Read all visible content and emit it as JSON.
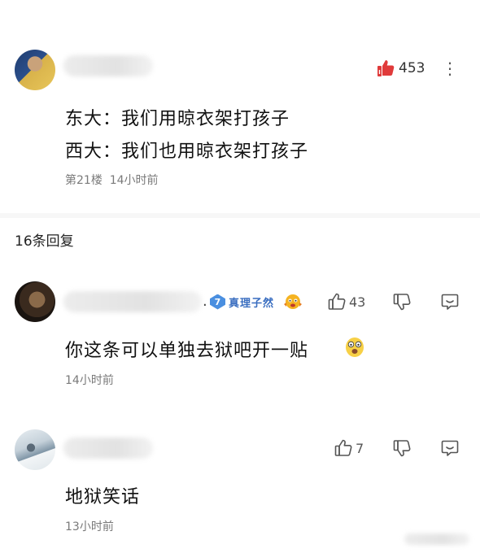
{
  "post": {
    "like_count": "453",
    "line1": "东大：我们用晾衣架打孩子",
    "line2": "西大：我们也用晾衣架打孩子",
    "floor": "第21楼",
    "time": "14小时前",
    "more": "⋮"
  },
  "replies_header": "16条回复",
  "replies": [
    {
      "separator": ".",
      "level": "7",
      "badge_title": "真理子然",
      "like_count": "43",
      "text": "你这条可以单独去狱吧开一贴",
      "time": "14小时前"
    },
    {
      "like_count": "7",
      "text": "地狱笑话",
      "time": "13小时前"
    }
  ],
  "colors": {
    "like_red": "#e03a3a",
    "badge_blue": "#4a8fe0",
    "meta_gray": "#7a7a7a"
  }
}
